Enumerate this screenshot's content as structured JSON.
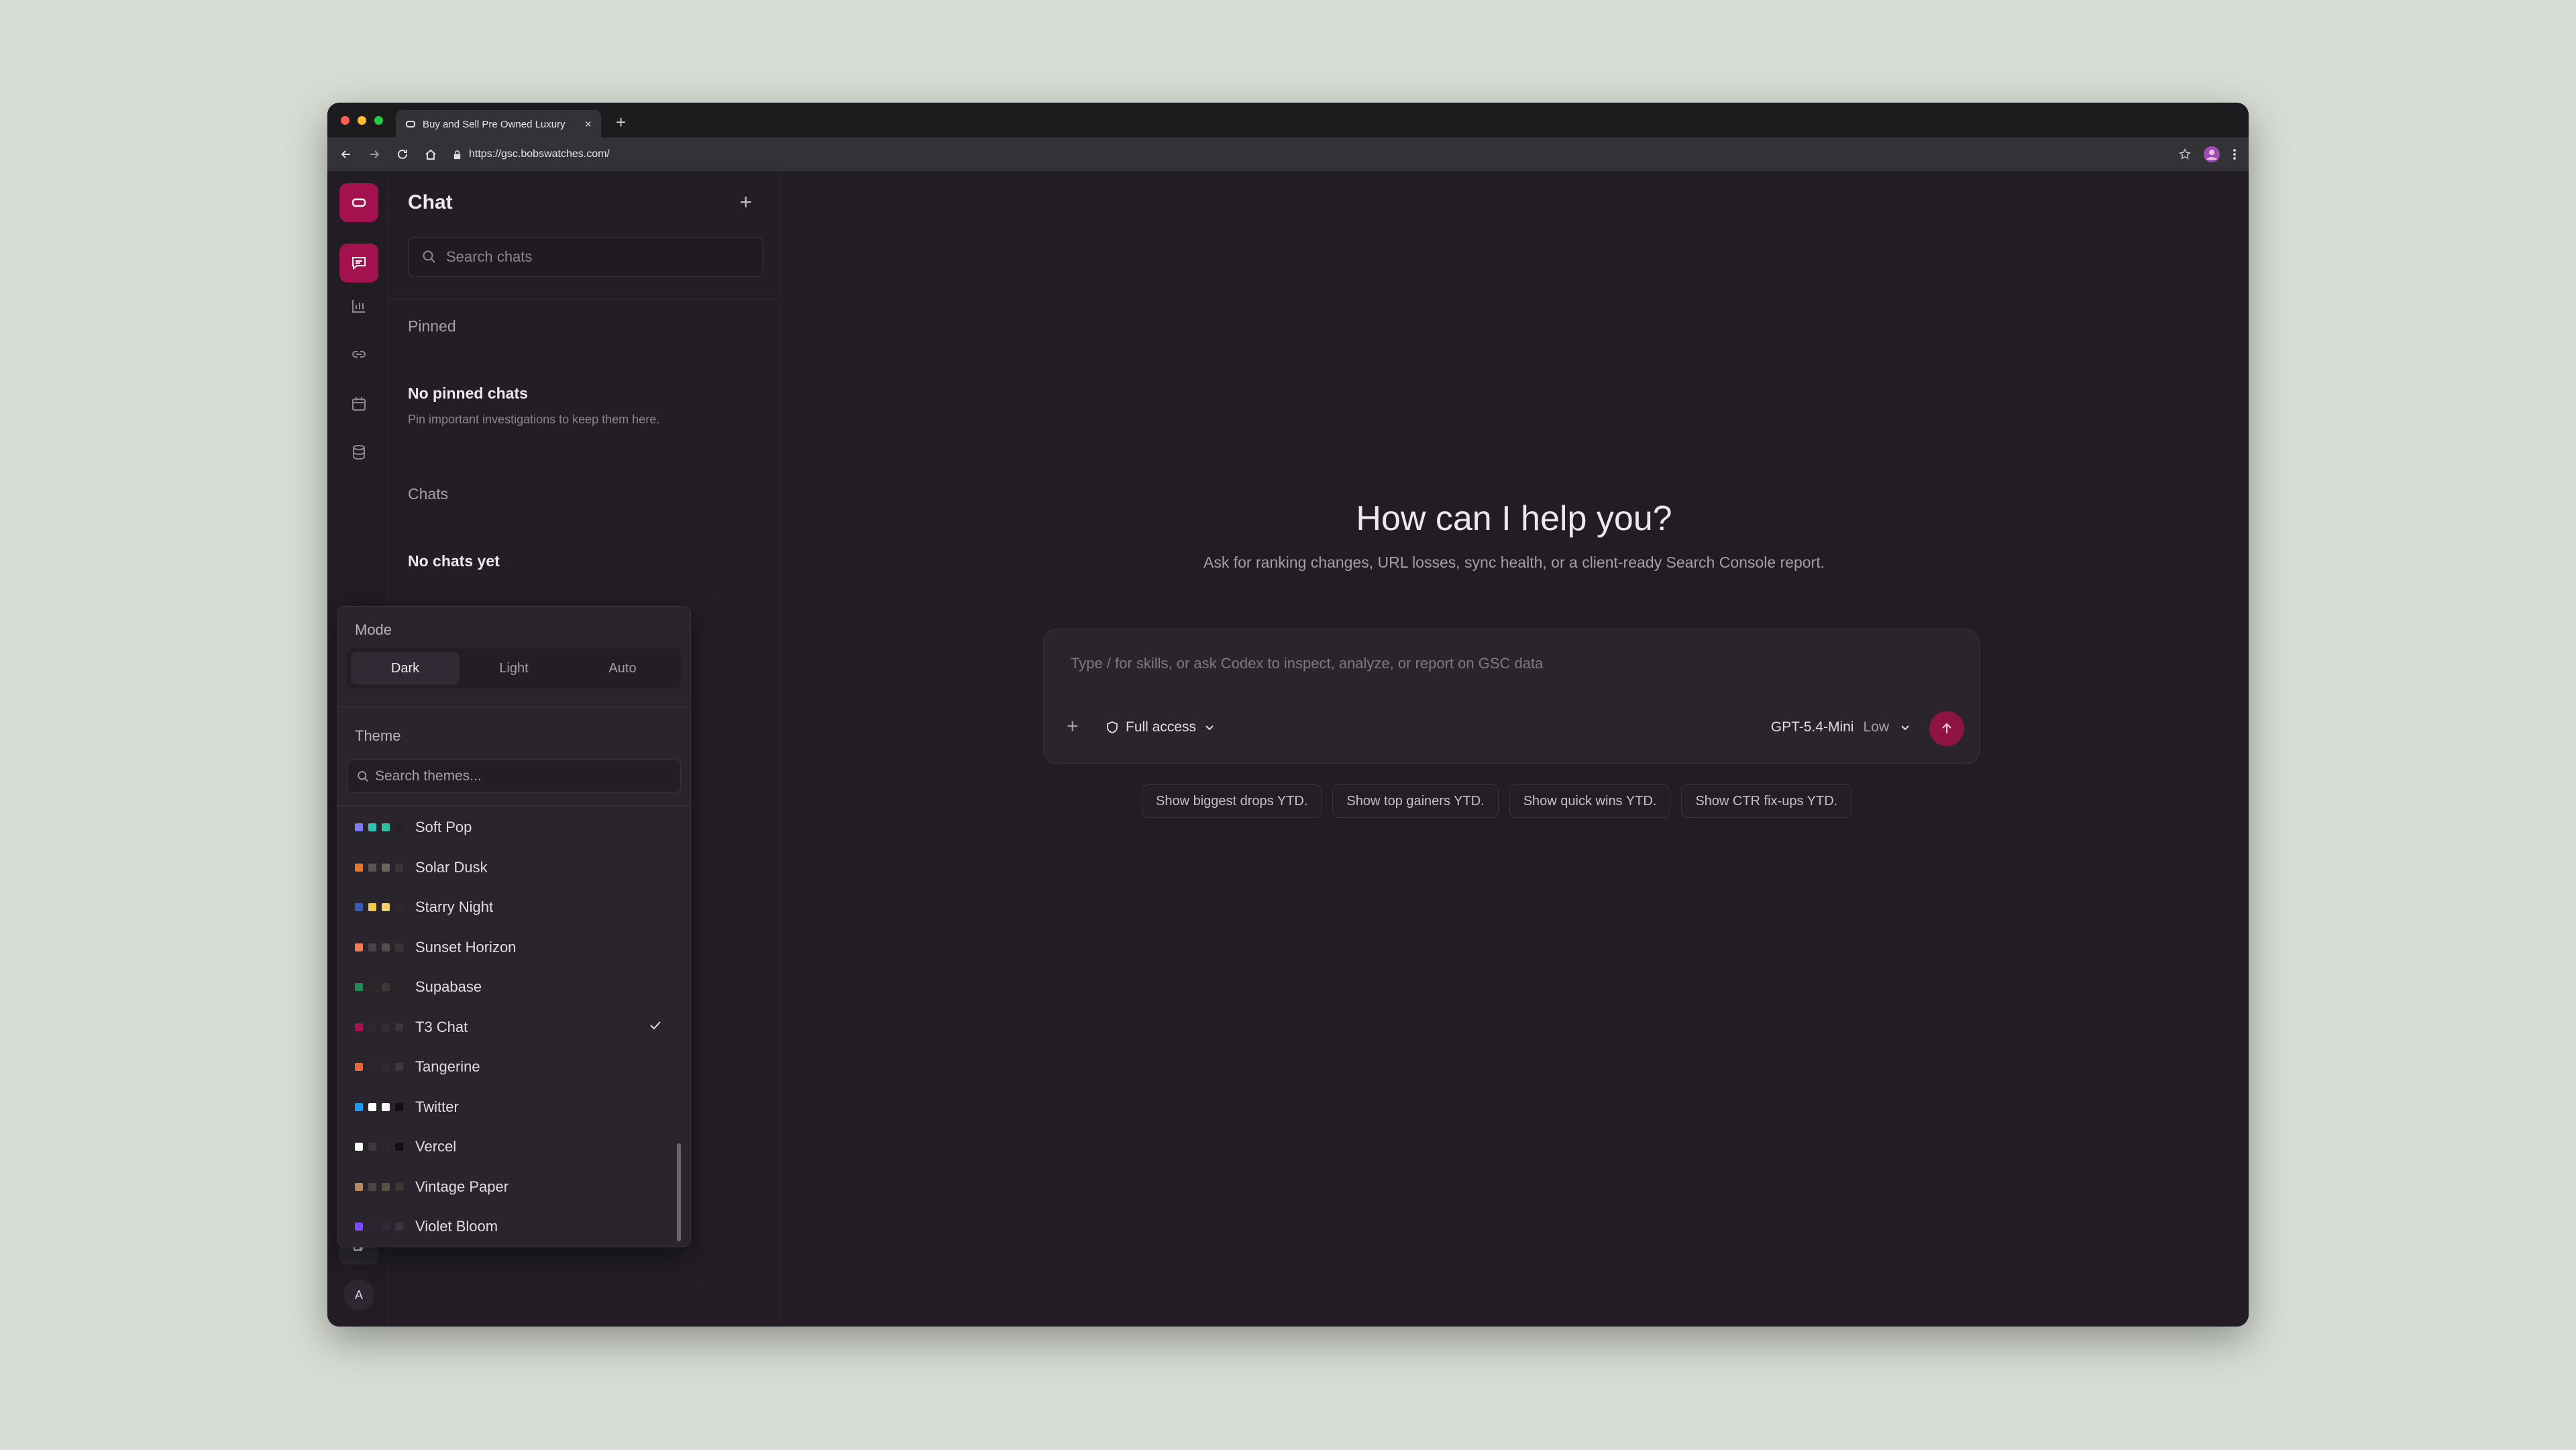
{
  "browser": {
    "tab_title": "Buy and Sell Pre Owned Luxury",
    "url": "https://gsc.bobswatches.com/"
  },
  "sidebar": {
    "title": "Chat",
    "search_placeholder": "Search chats",
    "pinned_label": "Pinned",
    "no_pinned_title": "No pinned chats",
    "no_pinned_sub": "Pin important investigations to keep them here.",
    "chats_label": "Chats",
    "no_chats_title": "No chats yet"
  },
  "main": {
    "heading": "How can I help you?",
    "subheading": "Ask for ranking changes, URL losses, sync health, or a client-ready Search Console report.",
    "composer_placeholder": "Type / for skills, or ask Codex to inspect, analyze, or report on GSC data",
    "access_label": "Full access",
    "model_label": "GPT-5.4-Mini",
    "effort_label": "Low",
    "chips": [
      "Show biggest drops YTD.",
      "Show top gainers YTD.",
      "Show quick wins YTD.",
      "Show CTR fix-ups YTD."
    ]
  },
  "popover": {
    "mode_label": "Mode",
    "modes": [
      "Dark",
      "Light",
      "Auto"
    ],
    "active_mode": "Dark",
    "theme_label": "Theme",
    "theme_search_placeholder": "Search themes...",
    "themes": [
      {
        "name": "Soft Pop",
        "colors": [
          "#7f7cf0",
          "#2ec4b6",
          "#2fbfa3",
          "#222222"
        ],
        "selected": false
      },
      {
        "name": "Solar Dusk",
        "colors": [
          "#e07a2f",
          "#5a5450",
          "#6b6560",
          "#3a3635"
        ],
        "selected": false
      },
      {
        "name": "Starry Night",
        "colors": [
          "#3b5bb5",
          "#f2c94c",
          "#f2d16b",
          "#2a2730"
        ],
        "selected": false
      },
      {
        "name": "Sunset Horizon",
        "colors": [
          "#f07a5a",
          "#4a4448",
          "#55504f",
          "#3a3538"
        ],
        "selected": false
      },
      {
        "name": "Supabase",
        "colors": [
          "#1f8a55",
          "#2a2a2a",
          "#3a3a3a",
          "#252525"
        ],
        "selected": false
      },
      {
        "name": "T3 Chat",
        "colors": [
          "#a3124e",
          "#2e2830",
          "#332d35",
          "#3a343d"
        ],
        "selected": true
      },
      {
        "name": "Tangerine",
        "colors": [
          "#e2683c",
          "#2a262c",
          "#2f2b31",
          "#3c3840"
        ],
        "selected": false
      },
      {
        "name": "Twitter",
        "colors": [
          "#1d9bf0",
          "#ffffff",
          "#f5f5f5",
          "#111111"
        ],
        "selected": false
      },
      {
        "name": "Vercel",
        "colors": [
          "#ffffff",
          "#3a3a3a",
          "#2a2a2a",
          "#111111"
        ],
        "selected": false
      },
      {
        "name": "Vintage Paper",
        "colors": [
          "#b58a5f",
          "#4d4540",
          "#5a524a",
          "#3d3733"
        ],
        "selected": false
      },
      {
        "name": "Violet Bloom",
        "colors": [
          "#7c4dff",
          "#2c2733",
          "#302b36",
          "#3a3441"
        ],
        "selected": false
      }
    ]
  },
  "rail": {
    "avatar_initial": "A"
  },
  "colors": {
    "accent": "#a3124e",
    "send_button": "#8e1342"
  }
}
